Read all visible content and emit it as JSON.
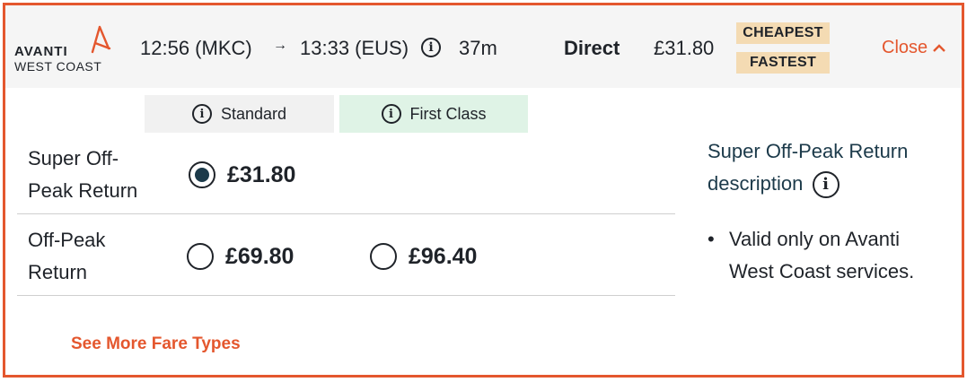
{
  "journey": {
    "operator_line1": "AVANTI",
    "operator_line2": "WEST COAST",
    "depart": "12:56 (MKC)",
    "arrow": "→",
    "arrive": "13:33 (EUS)",
    "duration": "37m",
    "changes": "Direct",
    "price": "£31.80",
    "badges": [
      "CHEAPEST",
      "FASTEST"
    ],
    "close_label": "Close",
    "info_glyph": "i"
  },
  "classes": [
    {
      "label": "Standard"
    },
    {
      "label": "First Class"
    }
  ],
  "fares": [
    {
      "name": "Super Off-Peak Return",
      "standard_price": "£31.80",
      "standard_selected": true
    },
    {
      "name": "Off-Peak Return",
      "standard_price": "£69.80",
      "first_price": "£96.40"
    }
  ],
  "description": {
    "title": "Super Off-Peak Return description",
    "items": [
      "Valid only on Avanti West Coast services."
    ]
  },
  "see_more_label": "See More Fare Types",
  "colors": {
    "accent": "#e4572e",
    "badge_bg": "#f4dbb3",
    "first_class_bg": "#dff3e6",
    "standard_bg": "#f1f1f1",
    "selected_radio": "#1c3a4a"
  }
}
